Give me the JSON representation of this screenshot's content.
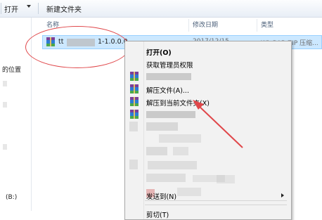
{
  "toolbar": {
    "open_label": "打开",
    "new_folder_label": "新建文件夹"
  },
  "nav": {
    "location_label": "的位置",
    "drive_label": "(B:)"
  },
  "columns": {
    "name": "名称",
    "date": "修改日期",
    "type": "类型"
  },
  "file": {
    "name_prefix": "tt",
    "name_suffix": "1-1.0.0.0.",
    "date": "2017/12/15 ",
    "type": "WinRAR ZIP 压缩..."
  },
  "menu": {
    "open": "打开(O)",
    "admin": "获取管理员权限",
    "extract_files": "解压文件(A)...",
    "extract_here": "解压到当前文件夹(X)",
    "send_to": "发送到(N)",
    "cut": "剪切(T)"
  },
  "colors": {
    "selection": "#cce8ff",
    "annotation": "#e0474a"
  },
  "icons": [
    "winrar-icon",
    "chevron-down-icon",
    "chevron-right-icon"
  ]
}
